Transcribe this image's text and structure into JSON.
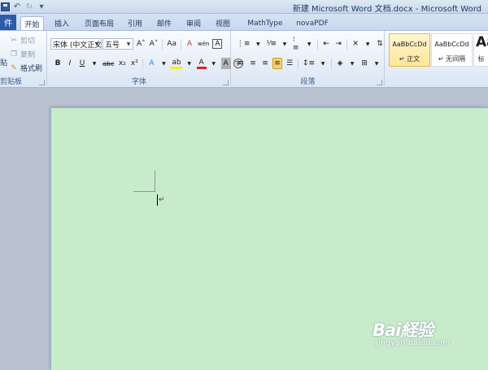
{
  "titlebar": {
    "title": "新建 Microsoft Word 文档.docx - Microsoft Word",
    "qat": {
      "save_icon": "save-icon",
      "undo_icon": "↶",
      "redo_icon": "↻",
      "customize_icon": "▾"
    }
  },
  "tabs": {
    "file": "件",
    "items": [
      "开始",
      "插入",
      "页面布局",
      "引用",
      "邮件",
      "审阅",
      "视图",
      "MathType",
      "novaPDF"
    ],
    "active_index": 0
  },
  "clipboard": {
    "paste_label": "贴",
    "cut_label": "剪切",
    "copy_label": "复制",
    "format_painter_label": "格式刷",
    "group_label": "剪贴板"
  },
  "font": {
    "font_name": "宋体 (中文正文",
    "font_size": "五号",
    "grow_icon": "A˄",
    "shrink_icon": "A˅",
    "change_case": "Aa",
    "clear_format_icon": "A",
    "phonetic_icon": "wén",
    "border_icon": "A",
    "bold": "B",
    "italic": "I",
    "underline": "U",
    "strikethrough": "abc",
    "subscript": "x₂",
    "superscript": "x²",
    "text_effect_icon": "A",
    "highlight_icon": "ab",
    "font_color_icon": "A",
    "shading_icon": "A",
    "enclose_icon": "字",
    "group_label": "字体"
  },
  "paragraph": {
    "group_label": "段落",
    "align_justify_active": true
  },
  "styles": {
    "items": [
      {
        "sample": "AaBbCcDd",
        "name": "↵ 正文",
        "selected": true
      },
      {
        "sample": "AaBbCcDd",
        "name": "↵ 无间隔",
        "selected": false
      },
      {
        "sample": "Aa",
        "name": "标",
        "selected": false
      }
    ]
  },
  "document": {
    "page_color": "#c7ebcb",
    "paragraph_mark": "↵"
  },
  "watermark": {
    "logo": "Bai経验",
    "url": "jingyan.baidu.com"
  },
  "colors": {
    "file_tab": "#2a5ca8",
    "selected_style": "#fde59a",
    "font_color_red": "#d8231f",
    "highlight_yellow": "#ffee00"
  }
}
